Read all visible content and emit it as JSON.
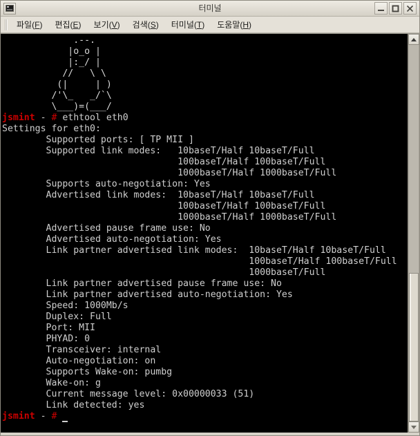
{
  "window": {
    "title": "터미널",
    "icon": "terminal-icon",
    "buttons": [
      {
        "name": "minimize-button",
        "label": "_"
      },
      {
        "name": "maximize-button",
        "label": "□"
      },
      {
        "name": "close-button",
        "label": "✕"
      }
    ]
  },
  "menubar": {
    "items": [
      {
        "name": "menu-file",
        "text": "파일(F)",
        "label": "파일",
        "mnemonic": "F"
      },
      {
        "name": "menu-edit",
        "text": "편집(E)",
        "label": "편집",
        "mnemonic": "E"
      },
      {
        "name": "menu-view",
        "text": "보기(V)",
        "label": "보기",
        "mnemonic": "V"
      },
      {
        "name": "menu-search",
        "text": "검색(S)",
        "label": "검색",
        "mnemonic": "S"
      },
      {
        "name": "menu-terminal",
        "text": "터미널(T)",
        "label": "터미널",
        "mnemonic": "T"
      },
      {
        "name": "menu-help",
        "text": "도움말(H)",
        "label": "도움말",
        "mnemonic": "H"
      }
    ]
  },
  "terminal": {
    "colors": {
      "background": "#000000",
      "foreground": "#cfcfcf",
      "prompt_user": "#cc0000",
      "prompt_symbol": "#cc0000"
    },
    "ascii_art": [
      "             .--.",
      "            |o_o |",
      "            |:_/ |",
      "           //   \\ \\",
      "          (|     | )",
      "         /'\\_   _/`\\",
      "         \\___)=(___/"
    ],
    "prompt": {
      "user": "jsmint",
      "separator": "-",
      "symbol": "#"
    },
    "command": "ethtool eth0",
    "output_lines": [
      "Settings for eth0:",
      "        Supported ports: [ TP MII ]",
      "        Supported link modes:   10baseT/Half 10baseT/Full",
      "                                100baseT/Half 100baseT/Full",
      "                                1000baseT/Half 1000baseT/Full",
      "        Supports auto-negotiation: Yes",
      "        Advertised link modes:  10baseT/Half 10baseT/Full",
      "                                100baseT/Half 100baseT/Full",
      "                                1000baseT/Half 1000baseT/Full",
      "        Advertised pause frame use: No",
      "        Advertised auto-negotiation: Yes",
      "        Link partner advertised link modes:  10baseT/Half 10baseT/Full",
      "                                             100baseT/Half 100baseT/Full",
      "                                             1000baseT/Full",
      "        Link partner advertised pause frame use: No",
      "        Link partner advertised auto-negotiation: Yes",
      "        Speed: 1000Mb/s",
      "        Duplex: Full",
      "        Port: MII",
      "        PHYAD: 0",
      "        Transceiver: internal",
      "        Auto-negotiation: on",
      "        Supports Wake-on: pumbg",
      "        Wake-on: g",
      "        Current message level: 0x00000033 (51)",
      "        Link detected: yes"
    ],
    "cursor": "_"
  },
  "scrollbar": {
    "up_arrow": "scroll-up-icon",
    "down_arrow": "scroll-down-icon",
    "thumb_top_percent": "60.5"
  }
}
